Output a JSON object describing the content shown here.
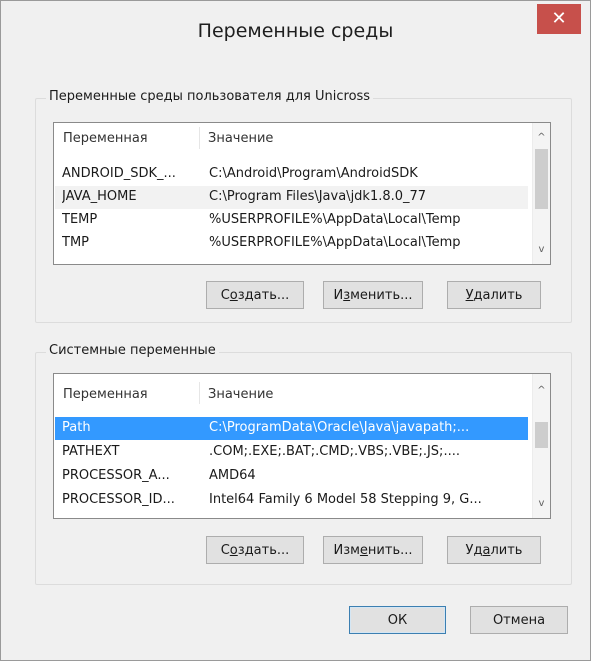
{
  "window": {
    "title": "Переменные среды",
    "close_glyph": "✕",
    "close_color": "#c7504b"
  },
  "user_group": {
    "title": "Переменные среды пользователя для Unicross",
    "columns": [
      "Переменная",
      "Значение"
    ],
    "rows": [
      {
        "name": "ANDROID_SDK_...",
        "value": "C:\\Android\\Program\\AndroidSDK"
      },
      {
        "name": "JAVA_HOME",
        "value": "C:\\Program Files\\Java\\jdk1.8.0_77"
      },
      {
        "name": "TEMP",
        "value": "%USERPROFILE%\\AppData\\Local\\Temp"
      },
      {
        "name": "TMP",
        "value": "%USERPROFILE%\\AppData\\Local\\Temp"
      }
    ],
    "buttons": {
      "new_pre": "С",
      "new_key": "о",
      "new_post": "здать...",
      "edit_pre": "И",
      "edit_key": "з",
      "edit_post": "менить...",
      "delete_pre": "",
      "delete_key": "У",
      "delete_post": "далить"
    }
  },
  "system_group": {
    "title": "Системные переменные",
    "columns": [
      "Переменная",
      "Значение"
    ],
    "rows": [
      {
        "name": "Path",
        "value": "C:\\ProgramData\\Oracle\\Java\\javapath;..."
      },
      {
        "name": "PATHEXT",
        "value": ".COM;.EXE;.BAT;.CMD;.VBS;.VBE;.JS;...."
      },
      {
        "name": "PROCESSOR_A...",
        "value": "AMD64"
      },
      {
        "name": "PROCESSOR_ID...",
        "value": "Intel64 Family 6 Model 58 Stepping 9, G..."
      }
    ],
    "selected_color": "#3399ff",
    "buttons": {
      "new_pre": "С",
      "new_key": "о",
      "new_post": "здать...",
      "edit_pre": "Изм",
      "edit_key": "е",
      "edit_post": "нить...",
      "delete_pre": "Уд",
      "delete_key": "а",
      "delete_post": "лить"
    }
  },
  "footer": {
    "ok_label": "ОК",
    "cancel_label": "Отмена"
  },
  "icons": {
    "scroll_up": "^",
    "scroll_down": "v"
  }
}
